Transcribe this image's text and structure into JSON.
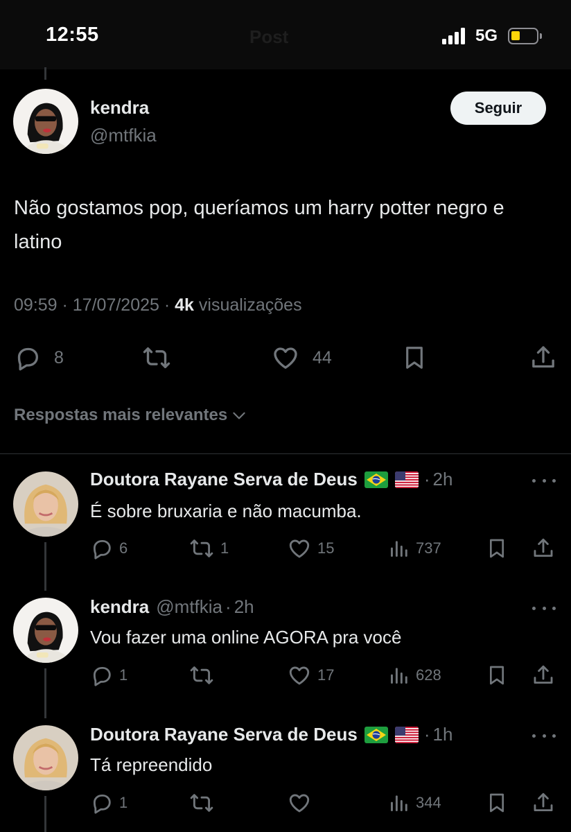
{
  "status_bar": {
    "time": "12:55",
    "network": "5G",
    "faded_title": "Post",
    "battery_level": 0.25
  },
  "post": {
    "display_name": "kendra",
    "handle": "@mtfkia",
    "follow_label": "Seguir",
    "text": "Não gostamos pop, queríamos um harry potter negro e latino",
    "time": "09:59",
    "date": "17/07/2025",
    "views_count": "4k",
    "views_label": "visualizações",
    "replies": "8",
    "likes": "44"
  },
  "sort": {
    "label": "Respostas mais relevantes"
  },
  "replies": [
    {
      "display_name": "Doutora Rayane Serva de Deus",
      "flags": [
        "brazil-flag",
        "usa-flag"
      ],
      "time": "2h",
      "text": "É sobre bruxaria e não macumba.",
      "replies": "6",
      "reposts": "1",
      "likes": "15",
      "views": "737"
    },
    {
      "display_name": "kendra",
      "handle": "@mtfkia",
      "time": "2h",
      "text": "Vou fazer uma online AGORA pra você",
      "replies": "1",
      "reposts": "",
      "likes": "17",
      "views": "628"
    },
    {
      "display_name": "Doutora Rayane Serva de Deus",
      "flags": [
        "brazil-flag",
        "usa-flag"
      ],
      "time": "1h",
      "text": "Tá repreendido",
      "replies": "1",
      "reposts": "",
      "likes": "",
      "views": "344"
    }
  ],
  "colors": {
    "background": "#000000",
    "text": "#e7e9ea",
    "muted": "#71767b",
    "divider": "#2f3336",
    "follow_button": "#eff3f4",
    "battery": "#ffd60a"
  },
  "icons": [
    "reply-icon",
    "repost-icon",
    "like-icon",
    "bookmark-icon",
    "share-icon",
    "views-icon",
    "more-icon",
    "chevron-down-icon"
  ]
}
